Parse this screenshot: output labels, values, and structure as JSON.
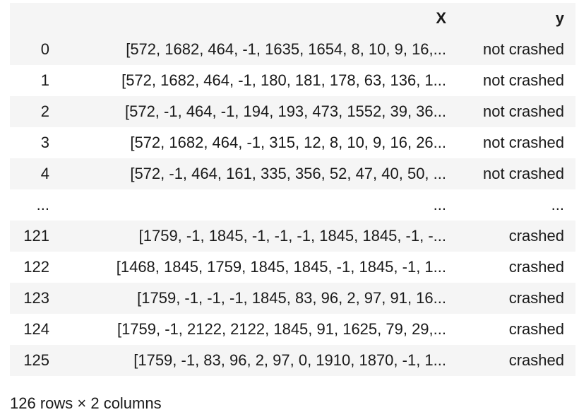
{
  "table": {
    "columns": [
      "",
      "X",
      "y"
    ],
    "rows": [
      {
        "index": "0",
        "X": "[572, 1682, 464, -1, 1635, 1654, 8, 10, 9, 16,...",
        "y": "not crashed"
      },
      {
        "index": "1",
        "X": "[572, 1682, 464, -1, 180, 181, 178, 63, 136, 1...",
        "y": "not crashed"
      },
      {
        "index": "2",
        "X": "[572, -1, 464, -1, 194, 193, 473, 1552, 39, 36...",
        "y": "not crashed"
      },
      {
        "index": "3",
        "X": "[572, 1682, 464, -1, 315, 12, 8, 10, 9, 16, 26...",
        "y": "not crashed"
      },
      {
        "index": "4",
        "X": "[572, -1, 464, 161, 335, 356, 52, 47, 40, 50, ...",
        "y": "not crashed"
      },
      {
        "index": "...",
        "X": "...",
        "y": "..."
      },
      {
        "index": "121",
        "X": "[1759, -1, 1845, -1, -1, -1, 1845, 1845, -1, -...",
        "y": "crashed"
      },
      {
        "index": "122",
        "X": "[1468, 1845, 1759, 1845, 1845, -1, 1845, -1, 1...",
        "y": "crashed"
      },
      {
        "index": "123",
        "X": "[1759, -1, -1, -1, 1845, 83, 96, 2, 97, 91, 16...",
        "y": "crashed"
      },
      {
        "index": "124",
        "X": "[1759, -1, 2122, 2122, 1845, 91, 1625, 79, 29,...",
        "y": "crashed"
      },
      {
        "index": "125",
        "X": "[1759, -1, 83, 96, 2, 97, 0, 1910, 1870, -1, 1...",
        "y": "crashed"
      }
    ]
  },
  "shape_text": "126 rows × 2 columns"
}
